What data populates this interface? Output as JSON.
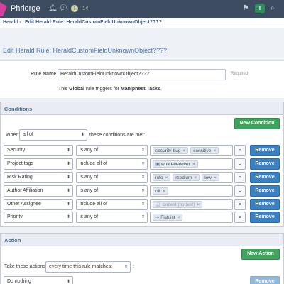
{
  "topbar": {
    "app_name": "Phriorge",
    "bell_icon": "bell-icon",
    "chat_icon": "chat-icon",
    "alert_icon": "alert-icon",
    "count": "14",
    "flag_icon": "flag-icon",
    "avatar_letter": "T",
    "search_icon": "search-icon"
  },
  "breadcrumb": {
    "items": [
      "Herald",
      "Edit Herald Rule: HeraldCustomFieldUnknownObject????"
    ],
    "separator": "›"
  },
  "page": {
    "title": "Edit Herald Rule: HeraldCustomFieldUnknownObject????",
    "rule_name_label": "Rule Name",
    "rule_name_value": "HeraldCustomFieldUnknownObject????",
    "required_text": "Required",
    "desc_prefix": "This ",
    "desc_global": "Global",
    "desc_middle": " rule triggers for ",
    "desc_object": "Maniphest Tasks",
    "desc_suffix": "."
  },
  "conditions": {
    "header": "Conditions",
    "new_button": "New Condition",
    "when_label": "When",
    "when_value": "all of",
    "met_text": "these conditions are met:",
    "rows": [
      {
        "field": "Security",
        "op": "is any of",
        "tags": [
          "security-bug",
          "sensitive"
        ],
        "disabled": false
      },
      {
        "field": "Project tags",
        "op": "include all of",
        "tags": [
          "whateeeeever"
        ],
        "disabled": false
      },
      {
        "field": "Risk Rating",
        "op": "is any of",
        "tags": [
          "info",
          "medium",
          "low"
        ],
        "disabled": false
      },
      {
        "field": "Author Affiliation",
        "op": "is any of",
        "tags": [
          "oit"
        ],
        "disabled": false
      },
      {
        "field": "Other Assignee",
        "op": "include all of",
        "tags": [
          "bottest (bottest)"
        ],
        "disabled": true
      },
      {
        "field": "Priority",
        "op": "is any of",
        "tags": [
          "Fishlist"
        ],
        "disabled": false
      }
    ],
    "remove_label": "Remove"
  },
  "action": {
    "header": "Action",
    "new_button": "New Action",
    "take_label": "Take these actions",
    "take_value": "every time this rule matches:",
    "colon": ":",
    "first_action": "Do nothing",
    "remove_label": "Remove"
  },
  "colors": {
    "topbar": "#3d4c61",
    "accent_blue": "#3b7fc4",
    "accent_green": "#3ea35b",
    "title": "#4a73b3"
  }
}
